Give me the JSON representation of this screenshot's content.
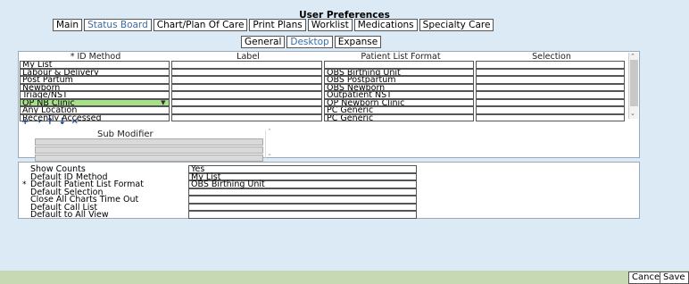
{
  "title": "User Preferences",
  "main_tabs": [
    "Main",
    "Status Board",
    "Chart/Plan Of Care",
    "Print Plans",
    "Worklist",
    "Medications",
    "Specialty Care"
  ],
  "sub_tabs": [
    "General",
    "Desktop",
    "Expanse"
  ],
  "grid": {
    "headers": [
      "* ID Method",
      "Label",
      "Patient List Format",
      "Selection"
    ],
    "rows": [
      {
        "id": "My List",
        "label": "",
        "format": "",
        "selection": ""
      },
      {
        "id": "Labour & Delivery",
        "label": "",
        "format": "OBS Birthing Unit",
        "selection": ""
      },
      {
        "id": "Post Partum",
        "label": "",
        "format": "OBS Postpartum",
        "selection": ""
      },
      {
        "id": "Newborn",
        "label": "",
        "format": "OBS Newborn",
        "selection": ""
      },
      {
        "id": "Triage/NST",
        "label": "",
        "format": "Outpatient NST",
        "selection": ""
      },
      {
        "id": "OP NB Clinic",
        "label": "",
        "format": "OP Newborn Clinic",
        "selection": ""
      },
      {
        "id": "Any Location",
        "label": "",
        "format": "PC Generic",
        "selection": ""
      },
      {
        "id": "Recently Accessed",
        "label": "",
        "format": "PC Generic",
        "selection": ""
      }
    ]
  },
  "sub_modifier_label": "Sub Modifier",
  "prefs": [
    {
      "label": "Show Counts",
      "value": "Yes",
      "required": false
    },
    {
      "label": "Default ID Method",
      "value": "My List",
      "required": false
    },
    {
      "label": "Default Patient List Format",
      "value": "OBS Birthing Unit",
      "required": true
    },
    {
      "label": "Default Selection",
      "value": "",
      "required": false
    },
    {
      "label": "Close All Charts Time Out",
      "value": "",
      "required": false
    },
    {
      "label": "Default Call List",
      "value": "",
      "required": false
    },
    {
      "label": "Default to All View",
      "value": "",
      "required": false
    }
  ],
  "footer": {
    "cancel": "Cancel",
    "save": "Save"
  },
  "colors": {
    "background": "#dbeaf5",
    "selected_row": "#a6e08a",
    "footer": "#c6d9b3",
    "inactive_tab": "#3a6aa8"
  }
}
